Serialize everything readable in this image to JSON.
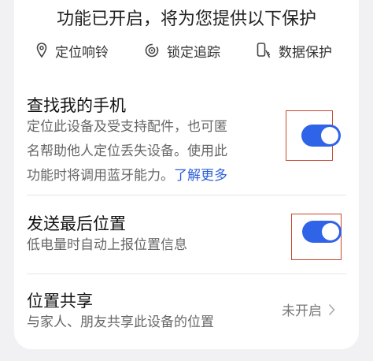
{
  "banner": {
    "title": "功能已开启，将为您提供以下保护",
    "features": [
      {
        "label": "定位响铃",
        "icon": "location-pin-icon"
      },
      {
        "label": "锁定追踪",
        "icon": "lock-track-icon"
      },
      {
        "label": "数据保护",
        "icon": "phone-clean-icon"
      }
    ]
  },
  "find_phone": {
    "title": "查找我的手机",
    "desc_line1": "定位此设备及受支持配件，也可匿",
    "desc_line2": "名帮助他人定位丢失设备。使用此",
    "desc_line3": "功能时将调用蓝牙能力。",
    "link": "了解更多",
    "enabled": true
  },
  "send_last_location": {
    "title": "发送最后位置",
    "desc": "低电量时自动上报位置信息",
    "enabled": true
  },
  "location_share": {
    "title": "位置共享",
    "desc": "与家人、朋友共享此设备的位置",
    "status": "未开启"
  },
  "colors": {
    "accent": "#2f63e8",
    "link": "#2b5fd9",
    "highlight_box": "#c9482f"
  }
}
